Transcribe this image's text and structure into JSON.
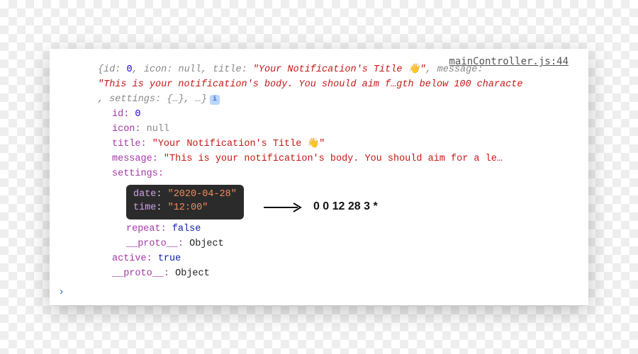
{
  "source_link": "mainController.js:44",
  "preview": {
    "open": "{",
    "id_key": "id:",
    "id_val": "0",
    "icon_key": "icon:",
    "icon_val": "null",
    "title_key": "title:",
    "title_val": "\"Your Notification's Title 👋\"",
    "msg_key": "message:",
    "msg_val": "\"This is your notification's body. You should aim f…gth below 100 characte",
    "settings_key": "settings:",
    "settings_val": "{…}",
    "rest": ", …}",
    "sep": ", "
  },
  "props": {
    "id": {
      "k": "id",
      "v": "0"
    },
    "icon": {
      "k": "icon",
      "v": "null"
    },
    "title": {
      "k": "title",
      "v": "\"Your Notification's Title 👋\""
    },
    "message": {
      "k": "message",
      "v": "\"This is your notification's body. You should aim for a le…"
    },
    "settings": {
      "k": "settings"
    },
    "date": {
      "k": "date",
      "v": "\"2020-04-28\""
    },
    "time": {
      "k": "time",
      "v": "\"12:00\""
    },
    "repeat": {
      "k": "repeat",
      "v": "false"
    },
    "proto1": {
      "k": "__proto__",
      "v": "Object"
    },
    "active": {
      "k": "active",
      "v": "true"
    },
    "proto2": {
      "k": "__proto__",
      "v": "Object"
    }
  },
  "annotation": "0 0 12 28 3 *",
  "info_badge": "i",
  "prompt": "›",
  "colon": ": ",
  "comma_space": ", "
}
